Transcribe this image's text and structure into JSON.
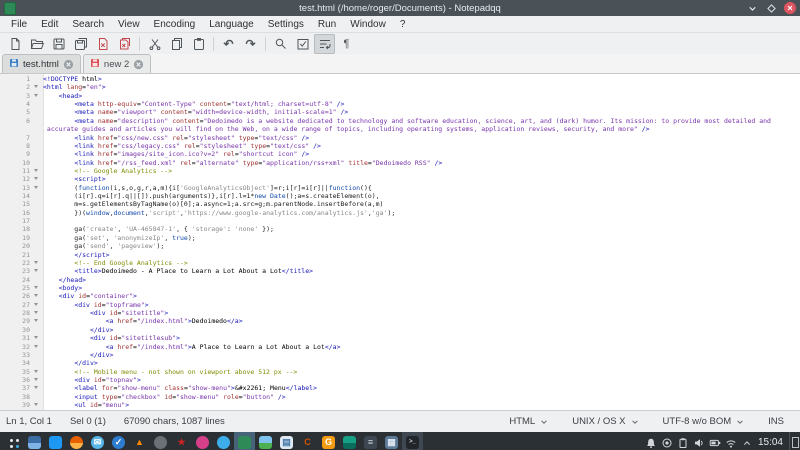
{
  "window": {
    "title": "test.html (/home/roger/Documents) - Notepadqq",
    "controls": [
      "minimize",
      "maximize",
      "close"
    ]
  },
  "menu": {
    "items": [
      "File",
      "Edit",
      "Search",
      "View",
      "Encoding",
      "Language",
      "Settings",
      "Run",
      "Window",
      "?"
    ]
  },
  "toolbar": {
    "buttons": [
      {
        "name": "new-file-button",
        "icon": "new"
      },
      {
        "name": "open-button",
        "icon": "open"
      },
      {
        "name": "save-button",
        "icon": "save"
      },
      {
        "name": "save-all-button",
        "icon": "saveall"
      },
      {
        "name": "close-button",
        "icon": "close"
      },
      {
        "name": "close-all-button",
        "icon": "closeall"
      },
      "|",
      {
        "name": "cut-button",
        "icon": "cut"
      },
      {
        "name": "copy-button",
        "icon": "copy"
      },
      {
        "name": "paste-button",
        "icon": "paste"
      },
      "|",
      {
        "name": "undo-button",
        "icon": "undo"
      },
      {
        "name": "redo-button",
        "icon": "redo"
      },
      "|",
      {
        "name": "search-button",
        "icon": "search"
      },
      {
        "name": "replace-button",
        "icon": "replace"
      },
      {
        "name": "word-wrap-button",
        "icon": "wrap",
        "active": true
      },
      {
        "name": "show-symbols-button",
        "icon": "pilcrow"
      }
    ]
  },
  "tabs": [
    {
      "label": "test.html",
      "saved": true,
      "active": true
    },
    {
      "label": "new 2",
      "saved": false,
      "active": false
    }
  ],
  "editor": {
    "lines": [
      {
        "n": "1",
        "t": "h",
        "s": "<!DOCTYPE html>"
      },
      {
        "n": "2",
        "t": "h",
        "f": true,
        "s": "<html lang=\"en\">"
      },
      {
        "n": "3",
        "t": "h",
        "f": true,
        "s": "    <head>"
      },
      {
        "n": "4",
        "t": "h",
        "s": "        <meta http-equiv=\"Content-Type\" content=\"text/html; charset=utf-8\" />"
      },
      {
        "n": "5",
        "t": "h",
        "s": "        <meta name=\"viewport\" content=\"width=device-width, initial-scale=1\" />"
      },
      {
        "n": "6",
        "t": "h",
        "s": "        <meta name=\"description\" content=\"Dedoimedo is a website dedicated to technology and software education, science, art, and (dark) humor. Its mission: to provide most detailed and"
      },
      {
        "n": "",
        "t": "h2",
        "s": " accurate guides and articles you will find on the Web, on a wide range of topics, including operating systems, application reviews, security, and more\" />"
      },
      {
        "n": "7",
        "t": "h",
        "s": "        <link href=\"css/new.css\" rel=\"stylesheet\" type=\"text/css\" />"
      },
      {
        "n": "8",
        "t": "h",
        "s": "        <link href=\"css/legacy.css\" rel=\"stylesheet\" type=\"text/css\" />"
      },
      {
        "n": "9",
        "t": "h",
        "s": "        <link href=\"images/site_icon.ico?v=2\" rel=\"shortcut icon\" />"
      },
      {
        "n": "10",
        "t": "h",
        "s": "        <link href=\"/rss_feed.xml\" rel=\"alternate\" type=\"application/rss+xml\" title=\"Dedoimedo RSS\" />"
      },
      {
        "n": "11",
        "t": "c",
        "f": true,
        "s": "        <!-- Google Analytics -->"
      },
      {
        "n": "12",
        "t": "h",
        "f": true,
        "s": "        <script>"
      },
      {
        "n": "13",
        "t": "j",
        "f": true,
        "s": "        (function(i,s,o,g,r,a,m){i['GoogleAnalyticsObject']=r;i[r]=i[r]||function(){"
      },
      {
        "n": "14",
        "t": "j",
        "s": "        (i[r].q=i[r].q||[]).push(arguments)},i[r].l=1*new Date();a=s.createElement(o),"
      },
      {
        "n": "15",
        "t": "j",
        "s": "        m=s.getElementsByTagName(o)[0];a.async=1;a.src=g;m.parentNode.insertBefore(a,m)"
      },
      {
        "n": "16",
        "t": "j",
        "s": "        })(window,document,'script','https://www.google-analytics.com/analytics.js','ga');"
      },
      {
        "n": "17",
        "t": "j",
        "s": ""
      },
      {
        "n": "18",
        "t": "j",
        "s": "        ga('create', 'UA-465847-1', { 'storage': 'none' });"
      },
      {
        "n": "19",
        "t": "j",
        "s": "        ga('set', 'anonymizeIp', true);"
      },
      {
        "n": "20",
        "t": "j",
        "s": "        ga('send', 'pageview');"
      },
      {
        "n": "21",
        "t": "h",
        "s": "        </script>"
      },
      {
        "n": "22",
        "t": "c",
        "f": true,
        "s": "        <!-- End Google Analytics -->"
      },
      {
        "n": "23",
        "t": "h",
        "f": true,
        "s": "        <title>Dedoimedo - A Place to Learn a Lot About a Lot</title>"
      },
      {
        "n": "24",
        "t": "h",
        "s": "    </head>"
      },
      {
        "n": "25",
        "t": "h",
        "f": true,
        "s": "    <body>"
      },
      {
        "n": "26",
        "t": "h",
        "f": true,
        "s": "    <div id=\"container\">"
      },
      {
        "n": "27",
        "t": "h",
        "f": true,
        "s": "        <div id=\"topframe\">"
      },
      {
        "n": "28",
        "t": "h",
        "f": true,
        "s": "            <div id=\"sitetitle\">"
      },
      {
        "n": "29",
        "t": "h",
        "f": true,
        "s": "                <a href=\"/index.html\">Dedoimedo</a>"
      },
      {
        "n": "30",
        "t": "h",
        "s": "            </div>"
      },
      {
        "n": "31",
        "t": "h",
        "f": true,
        "s": "            <div id=\"sitetitlesub\">"
      },
      {
        "n": "32",
        "t": "h",
        "f": true,
        "s": "                <a href=\"/index.html\">A Place to Learn a Lot About a Lot</a>"
      },
      {
        "n": "33",
        "t": "h",
        "s": "            </div>"
      },
      {
        "n": "34",
        "t": "h",
        "s": "        </div>"
      },
      {
        "n": "35",
        "t": "c",
        "f": true,
        "s": "        <!-- Mobile menu - not shown on viewport above 512 px -->"
      },
      {
        "n": "36",
        "t": "h",
        "f": true,
        "s": "        <div id=\"topnav\">"
      },
      {
        "n": "37",
        "t": "h",
        "f": true,
        "s": "        <label for=\"show-menu\" class=\"show-menu\">&#x2261; Menu</label>"
      },
      {
        "n": "38",
        "t": "h",
        "s": "        <input type=\"checkbox\" id=\"show-menu\" role=\"button\" />"
      },
      {
        "n": "39",
        "t": "h",
        "f": true,
        "s": "        <ul id=\"menu\">"
      }
    ]
  },
  "status": {
    "position": "Ln 1, Col 1",
    "selection": "Sel 0 (1)",
    "stats": "67090 chars, 1087 lines",
    "language": "HTML",
    "line_endings": "UNIX / OS X",
    "encoding": "UTF-8 w/o BOM",
    "insert_mode": "INS"
  },
  "colors": {
    "accent": "#3daee9",
    "titlebar": "#4a5157",
    "taskbar": "#2b3035",
    "close_red": "#dd5560",
    "tag_blue": "#1414b8",
    "attr_red": "#a03030",
    "string_purple": "#7733aa",
    "comment_olive": "#7f8c00",
    "saved_tab_icon": "#3d7fc4",
    "unsaved_tab_icon": "#e05258"
  },
  "taskbar": {
    "clock": "15:04",
    "apps": [
      {
        "name": "app-launcher-icon",
        "shape": "dots"
      },
      {
        "name": "display-settings-icon",
        "shape": "s",
        "c": "#3a6ea5",
        "c2": "#7fb2e5"
      },
      {
        "name": "file-manager-icon",
        "shape": "s",
        "c": "#1d99f3"
      },
      {
        "name": "firefox-icon",
        "shape": "c",
        "c": "#e66000",
        "c2": "#ffb347"
      },
      {
        "name": "mail-icon",
        "shape": "c",
        "c": "#58b6e8",
        "g": "✉",
        "gc": "#ffffff"
      },
      {
        "name": "chat-icon",
        "shape": "c",
        "c": "#2e7dd1",
        "g": "✓",
        "gc": "#ffffff"
      },
      {
        "name": "vlc-icon",
        "shape": "g",
        "g": "▲",
        "gc": "#ff8800"
      },
      {
        "name": "gimp-icon",
        "shape": "c",
        "c": "#6b6f76"
      },
      {
        "name": "leaf-icon",
        "shape": "g",
        "g": "★",
        "gc": "#cc2222"
      },
      {
        "name": "music-icon",
        "shape": "c",
        "c": "#d6408b"
      },
      {
        "name": "globe-icon",
        "shape": "c",
        "c": "#3daee9"
      },
      {
        "name": "notepadqq-icon",
        "shape": "s",
        "c": "#2e8b57",
        "cell": "#46637a"
      },
      {
        "name": "photos-icon",
        "shape": "s",
        "c": "#7ec3ee",
        "c2": "#4caf50"
      },
      {
        "name": "documents-icon",
        "shape": "s",
        "c": "#dfe9f2",
        "g": "▤",
        "gc": "#4477aa"
      },
      {
        "name": "c-app-icon",
        "shape": "g",
        "g": "C",
        "gc": "#d35400"
      },
      {
        "name": "g-app-icon",
        "shape": "s",
        "c": "#f39c12",
        "g": "G",
        "gc": "#ffffff"
      },
      {
        "name": "image-viewer-icon",
        "shape": "s",
        "c": "#16a085",
        "c2": "#0b6e5c"
      },
      {
        "name": "panel-settings-icon",
        "shape": "s",
        "c": "#3d4852",
        "g": "≡",
        "gc": "#cfd8dc"
      },
      {
        "name": "calculator-icon",
        "shape": "s",
        "c": "#5d7a99",
        "g": "▦",
        "gc": "#dce6f0"
      },
      {
        "name": "terminal-icon",
        "shape": "s",
        "c": "#22262a",
        "g": ">_",
        "gc": "#cfd6db",
        "cell": "#3f4850"
      }
    ],
    "tray": [
      "bell-icon",
      "record-icon",
      "clipboard-icon",
      "volume-icon",
      "battery-icon",
      "wifi-icon",
      "tray-expand-icon"
    ]
  }
}
